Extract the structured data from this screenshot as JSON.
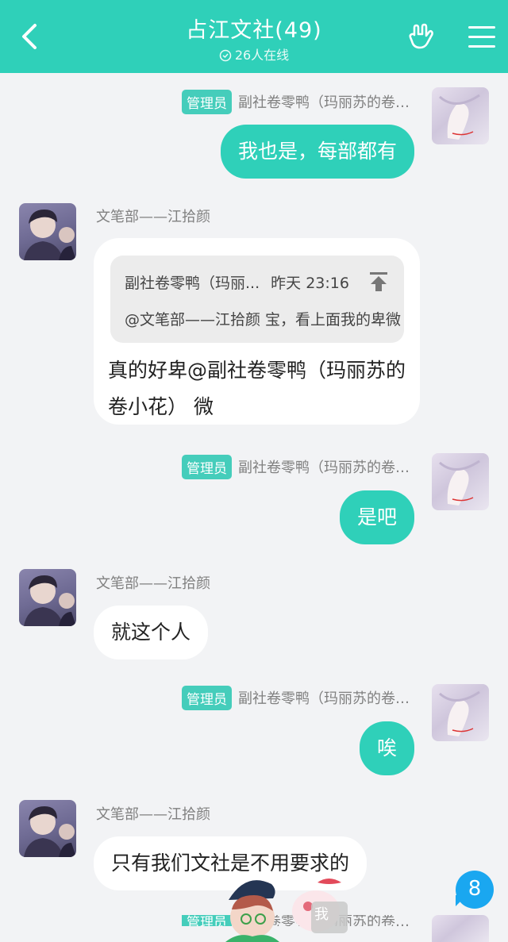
{
  "header": {
    "title": "占江文社(49)",
    "online": "26人在线",
    "accent": "#2fd0b9"
  },
  "icons": {
    "back": "chevron-left-icon",
    "hand": "hand-gesture-icon",
    "menu": "hamburger-menu-icon",
    "pin": "pin-to-top-icon",
    "online": "check-circle-icon"
  },
  "messages": [
    {
      "side": "out",
      "badge": "管理员",
      "sender": "副社卷零鸭（玛丽苏的卷…",
      "text": "我也是，每部都有"
    },
    {
      "side": "in",
      "sender": "文笔部——江拾颜",
      "quote": {
        "title": "副社卷零鸭（玛丽...",
        "time": "昨天 23:16",
        "text": "@文笔部——江拾颜 宝，看上面我的卑微"
      },
      "line1": "真的好卑@副社卷零鸭（玛丽苏的",
      "line2": "卷小花） 微"
    },
    {
      "side": "out",
      "badge": "管理员",
      "sender": "副社卷零鸭（玛丽苏的卷…",
      "text": "是吧"
    },
    {
      "side": "in",
      "sender": "文笔部——江拾颜",
      "text": "就这个人"
    },
    {
      "side": "out",
      "badge": "管理员",
      "sender": "副社卷零鸭（玛丽苏的卷…",
      "text": "唉"
    },
    {
      "side": "in",
      "sender": "文笔部——江拾颜",
      "text": "只有我们文社是不用要求的"
    }
  ],
  "partial": {
    "badge": "管理员",
    "sender": "副社卷零鸭（玛丽苏的卷…"
  },
  "unread_count": "8",
  "mascot_label": "我"
}
